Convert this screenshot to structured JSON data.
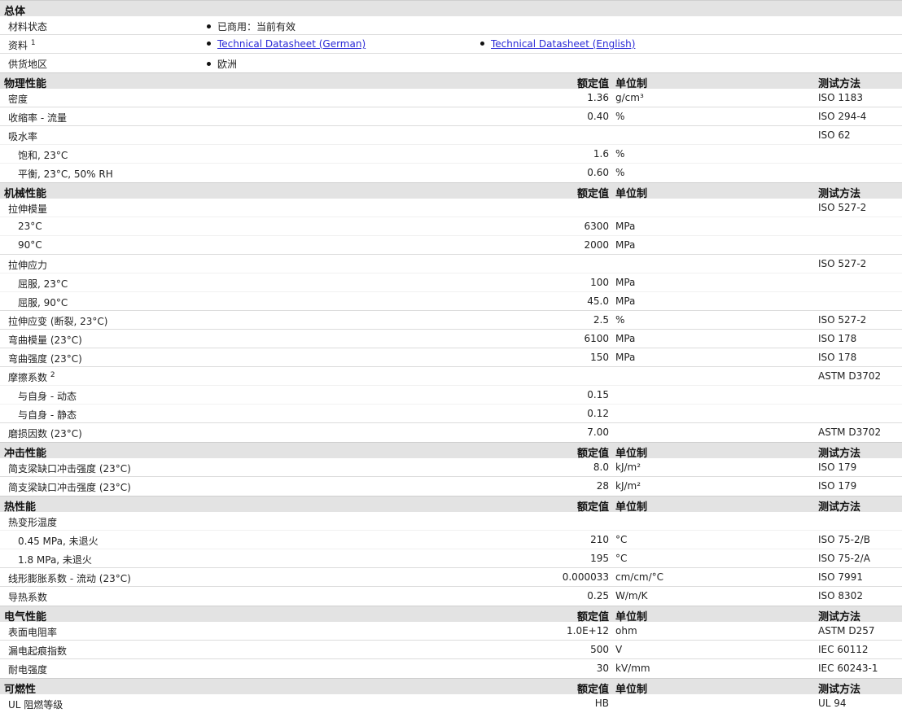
{
  "general": {
    "title": "总体",
    "rows": [
      {
        "label": "材料状态",
        "bullets": [
          "已商用：当前有效"
        ]
      },
      {
        "label": "资料",
        "sup": "1",
        "links": [
          "Technical Datasheet (German)",
          "Technical Datasheet (English)"
        ]
      },
      {
        "label": "供货地区",
        "bullets": [
          "欧洲"
        ]
      }
    ]
  },
  "headers": {
    "value": "额定值",
    "unit": "单位制",
    "method": "测试方法"
  },
  "sections": [
    {
      "title": "物理性能",
      "rows": [
        {
          "label": "密度",
          "value": "1.36",
          "unit": "g/cm³",
          "method": "ISO 1183"
        },
        {
          "label": "收缩率  - 流量",
          "value": "0.40",
          "unit": "%",
          "method": "ISO 294-4"
        },
        {
          "label": "吸水率",
          "method": "ISO 62",
          "cont": true
        },
        {
          "label": "饱和, 23°C",
          "value": "1.6",
          "unit": "%",
          "sub": true,
          "cont": true
        },
        {
          "label": "平衡, 23°C, 50% RH",
          "value": "0.60",
          "unit": "%",
          "sub": true,
          "last": true
        }
      ]
    },
    {
      "title": "机械性能",
      "rows": [
        {
          "label": "拉伸模量",
          "method": "ISO 527-2",
          "cont": true
        },
        {
          "label": "23°C",
          "value": "6300",
          "unit": "MPa",
          "sub": true,
          "cont": true
        },
        {
          "label": "90°C",
          "value": "2000",
          "unit": "MPa",
          "sub": true
        },
        {
          "label": "拉伸应力",
          "method": "ISO 527-2",
          "cont": true
        },
        {
          "label": "屈服, 23°C",
          "value": "100",
          "unit": "MPa",
          "sub": true,
          "cont": true
        },
        {
          "label": "屈服, 90°C",
          "value": "45.0",
          "unit": "MPa",
          "sub": true
        },
        {
          "label": "拉伸应变  (断裂, 23°C)",
          "value": "2.5",
          "unit": "%",
          "method": "ISO 527-2"
        },
        {
          "label": "弯曲模量  (23°C)",
          "value": "6100",
          "unit": "MPa",
          "method": "ISO 178"
        },
        {
          "label": "弯曲强度  (23°C)",
          "value": "150",
          "unit": "MPa",
          "method": "ISO 178"
        },
        {
          "label": "摩擦系数",
          "sup": "2",
          "method": "ASTM D3702",
          "cont": true
        },
        {
          "label": "与自身  - 动态",
          "value": "0.15",
          "sub": true,
          "cont": true
        },
        {
          "label": "与自身  - 静态",
          "value": "0.12",
          "sub": true
        },
        {
          "label": "磨损因数  (23°C)",
          "value": "7.00",
          "method": "ASTM D3702",
          "last": true
        }
      ]
    },
    {
      "title": "冲击性能",
      "rows": [
        {
          "label": "简支梁缺口冲击强度  (23°C)",
          "value": "8.0",
          "unit": "kJ/m²",
          "method": "ISO 179"
        },
        {
          "label": "简支梁缺口冲击强度  (23°C)",
          "value": "28",
          "unit": "kJ/m²",
          "method": "ISO 179",
          "last": true
        }
      ]
    },
    {
      "title": "热性能",
      "rows": [
        {
          "label": "热变形温度",
          "cont": true
        },
        {
          "label": "0.45 MPa, 未退火",
          "value": "210",
          "unit": "°C",
          "method": "ISO 75-2/B",
          "sub": true,
          "cont": true
        },
        {
          "label": "1.8 MPa, 未退火",
          "value": "195",
          "unit": "°C",
          "method": "ISO 75-2/A",
          "sub": true
        },
        {
          "label": "线形膨胀系数  - 流动  (23°C)",
          "value": "0.000033",
          "unit": "cm/cm/°C",
          "method": "ISO 7991"
        },
        {
          "label": "导热系数",
          "value": "0.25",
          "unit": "W/m/K",
          "method": "ISO 8302",
          "last": true
        }
      ]
    },
    {
      "title": "电气性能",
      "rows": [
        {
          "label": "表面电阻率",
          "value": "1.0E+12",
          "unit": "ohm",
          "method": "ASTM D257"
        },
        {
          "label": "漏电起痕指数",
          "value": "500",
          "unit": "V",
          "method": "IEC 60112"
        },
        {
          "label": "耐电强度",
          "value": "30",
          "unit": "kV/mm",
          "method": "IEC 60243-1",
          "last": true
        }
      ]
    },
    {
      "title": "可燃性",
      "rows": [
        {
          "label": "UL 阻燃等级",
          "value": "HB",
          "method": "UL 94",
          "last": true
        }
      ]
    }
  ]
}
